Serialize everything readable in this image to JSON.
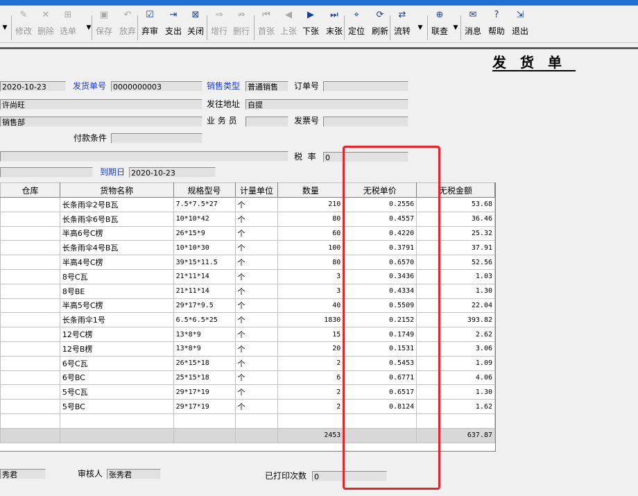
{
  "toolbar": {
    "buttons": [
      {
        "label": "修改",
        "icon": "edit-icon",
        "glyph": "✎",
        "enabled": false
      },
      {
        "label": "删除",
        "icon": "delete-icon",
        "glyph": "✕",
        "enabled": false
      },
      {
        "label": "选单",
        "icon": "select-icon",
        "glyph": "⊞",
        "enabled": false
      },
      {
        "label": "保存",
        "icon": "save-icon",
        "glyph": "▣",
        "enabled": false
      },
      {
        "label": "放弃",
        "icon": "undo-icon",
        "glyph": "↶",
        "enabled": false
      },
      {
        "label": "弃审",
        "icon": "unaudit-icon",
        "glyph": "☑",
        "enabled": true
      },
      {
        "label": "支出",
        "icon": "payout-icon",
        "glyph": "⇥",
        "enabled": true
      },
      {
        "label": "关闭",
        "icon": "close-doc-icon",
        "glyph": "⊠",
        "enabled": true
      },
      {
        "label": "增行",
        "icon": "add-row-icon",
        "glyph": "⇒",
        "enabled": false
      },
      {
        "label": "删行",
        "icon": "delete-row-icon",
        "glyph": "⇏",
        "enabled": false
      },
      {
        "label": "首张",
        "icon": "first-icon",
        "glyph": "⏮",
        "enabled": false
      },
      {
        "label": "上张",
        "icon": "prev-icon",
        "glyph": "◀",
        "enabled": false
      },
      {
        "label": "下张",
        "icon": "next-icon",
        "glyph": "▶",
        "enabled": true
      },
      {
        "label": "末张",
        "icon": "last-icon",
        "glyph": "⏭",
        "enabled": true
      },
      {
        "label": "定位",
        "icon": "locate-icon",
        "glyph": "⌖",
        "enabled": true
      },
      {
        "label": "刷新",
        "icon": "refresh-icon",
        "glyph": "⟳",
        "enabled": true
      },
      {
        "label": "流转",
        "icon": "flow-icon",
        "glyph": "⇄",
        "enabled": true
      },
      {
        "label": "联查",
        "icon": "link-query-icon",
        "glyph": "⊕",
        "enabled": true
      },
      {
        "label": "消息",
        "icon": "message-icon",
        "glyph": "✉",
        "enabled": true
      },
      {
        "label": "帮助",
        "icon": "help-icon",
        "glyph": "?",
        "enabled": true
      },
      {
        "label": "退出",
        "icon": "exit-icon",
        "glyph": "⇲",
        "enabled": true
      }
    ]
  },
  "form": {
    "title": "发货单",
    "date_value": "2020-10-23",
    "ship_no_label": "发货单号",
    "ship_no_value": "0000000003",
    "sales_type_label": "销售类型",
    "sales_type_value": "普通销售",
    "order_no_label": "订单号",
    "order_no_value": "",
    "customer_value": "许尚旺",
    "ship_addr_label": "发往地址",
    "ship_addr_value": "自提",
    "dept_value": "销售部",
    "salesman_label": "业 务 员",
    "salesman_value": "",
    "invoice_label": "发票号",
    "invoice_value": "",
    "pay_terms_label": "付款条件",
    "pay_terms_value": "",
    "remark_value": "",
    "tax_label": "税  率",
    "tax_value": "0",
    "due_date_label": "到期日",
    "due_date_value": "2020-10-23"
  },
  "grid": {
    "headers": [
      "仓库",
      "货物名称",
      "规格型号",
      "计量单位",
      "数量",
      "无税单价",
      "无税金额"
    ],
    "rows": [
      [
        "",
        "长条雨伞2号B瓦",
        "7.5*7.5*27",
        "个",
        "210",
        "0.2556",
        "53.68"
      ],
      [
        "",
        "长条雨伞6号B瓦",
        "10*10*42",
        "个",
        "80",
        "0.4557",
        "36.46"
      ],
      [
        "",
        "半高6号C楞",
        "26*15*9",
        "个",
        "60",
        "0.4220",
        "25.32"
      ],
      [
        "",
        "长条雨伞4号B瓦",
        "10*10*30",
        "个",
        "100",
        "0.3791",
        "37.91"
      ],
      [
        "",
        "半高4号C楞",
        "39*15*11.5",
        "个",
        "80",
        "0.6570",
        "52.56"
      ],
      [
        "",
        "8号C瓦",
        "21*11*14",
        "个",
        "3",
        "0.3436",
        "1.03"
      ],
      [
        "",
        "8号BE",
        "21*11*14",
        "个",
        "3",
        "0.4334",
        "1.30"
      ],
      [
        "",
        "半高5号C楞",
        "29*17*9.5",
        "个",
        "40",
        "0.5509",
        "22.04"
      ],
      [
        "",
        "长条雨伞1号",
        "6.5*6.5*25",
        "个",
        "1830",
        "0.2152",
        "393.82"
      ],
      [
        "",
        "12号C楞",
        "13*8*9",
        "个",
        "15",
        "0.1749",
        "2.62"
      ],
      [
        "",
        "12号B楞",
        "13*8*9",
        "个",
        "20",
        "0.1531",
        "3.06"
      ],
      [
        "",
        "6号C瓦",
        "26*15*18",
        "个",
        "2",
        "0.5453",
        "1.09"
      ],
      [
        "",
        "6号BC",
        "25*15*18",
        "个",
        "6",
        "0.6771",
        "4.06"
      ],
      [
        "",
        "5号C瓦",
        "29*17*19",
        "个",
        "2",
        "0.6517",
        "1.30"
      ],
      [
        "",
        "5号BC",
        "29*17*19",
        "个",
        "2",
        "0.8124",
        "1.62"
      ]
    ],
    "total": {
      "qty": "2453",
      "amount": "637.87"
    }
  },
  "footer": {
    "maker_value": "秀君",
    "reviewer_label": "审核人",
    "reviewer_value": "张秀君",
    "print_count_label": "已打印次数",
    "print_count_value": "0"
  },
  "colors": {
    "highlight": "#e8232c",
    "label_blue": "#1b3bd6",
    "toolbar_icon": "#1a3f9a"
  }
}
